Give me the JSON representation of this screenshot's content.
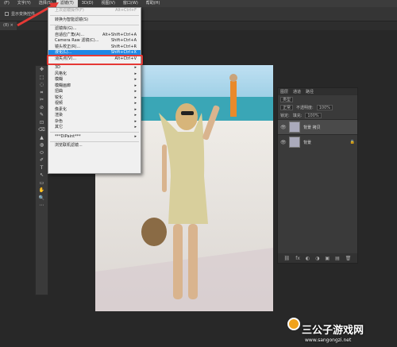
{
  "menubar": {
    "items": [
      "(F)",
      "文字(Y)",
      "选择(S)",
      "滤镜(T)",
      "3D(D)",
      "视图(V)",
      "窗口(W)",
      "帮助(H)"
    ],
    "active_index": 3
  },
  "optbar": {
    "checkbox_label": "显示变换控件"
  },
  "tab": {
    "label": "(8) ×"
  },
  "filter_menu": {
    "items": [
      {
        "label": "上次滤镜操作(F)",
        "shortcut": "Alt+Ctrl+F",
        "state": "disabled"
      },
      {
        "sep": true
      },
      {
        "label": "转换为智能滤镜(S)",
        "shortcut": ""
      },
      {
        "sep": true
      },
      {
        "label": "滤镜库(G)...",
        "shortcut": ""
      },
      {
        "label": "自适应广角(A)...",
        "shortcut": "Alt+Shift+Ctrl+A"
      },
      {
        "label": "Camera Raw 滤镜(C)...",
        "shortcut": "Shift+Ctrl+A"
      },
      {
        "label": "镜头校正(R)...",
        "shortcut": "Shift+Ctrl+R"
      },
      {
        "label": "液化(L)...",
        "shortcut": "Shift+Ctrl+X",
        "state": "highlight"
      },
      {
        "label": "消失点(V)...",
        "shortcut": "Alt+Ctrl+V"
      },
      {
        "sep": true
      },
      {
        "label": "3D",
        "sub": true
      },
      {
        "label": "风格化",
        "sub": true
      },
      {
        "label": "模糊",
        "sub": true
      },
      {
        "label": "模糊画廊",
        "sub": true
      },
      {
        "label": "扭曲",
        "sub": true
      },
      {
        "label": "锐化",
        "sub": true
      },
      {
        "label": "视频",
        "sub": true
      },
      {
        "label": "像素化",
        "sub": true
      },
      {
        "label": "渲染",
        "sub": true
      },
      {
        "label": "杂色",
        "sub": true
      },
      {
        "label": "其它",
        "sub": true
      },
      {
        "sep": true
      },
      {
        "label": "***DiPaint***",
        "sub": true
      },
      {
        "sep": true
      },
      {
        "label": "浏览联机滤镜...",
        "shortcut": ""
      }
    ]
  },
  "tools": [
    "✥",
    "⬚",
    "◌",
    "⌗",
    "✂",
    "⊘",
    "✎",
    "⊡",
    "⌫",
    "▲",
    "◍",
    "⬭",
    "✐",
    "T",
    "↖",
    "▭",
    "✋",
    "🔍",
    "⋯"
  ],
  "layers_panel": {
    "tabs": [
      "图层",
      "通道",
      "路径"
    ],
    "kind_label": "类型",
    "blend_mode": "正常",
    "opacity_label": "不透明度:",
    "opacity_value": "100%",
    "lock_label": "锁定:",
    "fill_label": "填充:",
    "fill_value": "100%",
    "layers": [
      {
        "name": "背景 拷贝",
        "selected": true
      },
      {
        "name": "背景",
        "selected": false,
        "locked": true
      }
    ],
    "footer_icons": [
      "⛓",
      "fx",
      "◐",
      "◑",
      "▣",
      "▤",
      "🗑"
    ]
  },
  "watermark": {
    "title": "三公子游戏网",
    "url": "www.sangongzi.net"
  }
}
